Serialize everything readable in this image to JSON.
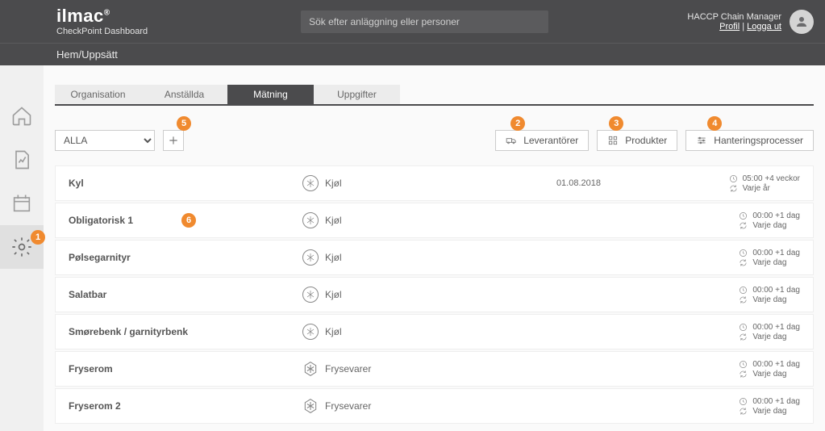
{
  "header": {
    "brand_main": "ilmac",
    "brand_sub": "CheckPoint Dashboard",
    "search_placeholder": "Sök efter anläggning eller personer",
    "role_label": "HACCP Chain Manager",
    "profile_link": "Profil",
    "separator": " | ",
    "logout_link": "Logga ut"
  },
  "breadcrumbs": {
    "home": "Hem",
    "sep": " / ",
    "current": "Uppsätt"
  },
  "tabs": {
    "organisation": "Organisation",
    "anstallda": "Anställda",
    "matning": "Mätning",
    "uppgifter": "Uppgifter"
  },
  "toolbar": {
    "select_value": "ALLA",
    "leverantorer": "Leverantörer",
    "produkter": "Produkter",
    "hantering": "Hanteringsprocesser"
  },
  "annotations": {
    "n1": "1",
    "n2": "2",
    "n3": "3",
    "n4": "4",
    "n5": "5",
    "n6": "6"
  },
  "types": {
    "kjol": "Kjøl",
    "frysevarer": "Frysevarer"
  },
  "rows": [
    {
      "name": "Kyl",
      "type": "kjol",
      "date": "01.08.2018",
      "time": "05:00 +4 veckor",
      "repeat": "Varje år"
    },
    {
      "name": "Obligatorisk 1",
      "type": "kjol",
      "date": "",
      "time": "00:00 +1 dag",
      "repeat": "Varje dag"
    },
    {
      "name": "Pølsegarnityr",
      "type": "kjol",
      "date": "",
      "time": "00:00 +1 dag",
      "repeat": "Varje dag"
    },
    {
      "name": "Salatbar",
      "type": "kjol",
      "date": "",
      "time": "00:00 +1 dag",
      "repeat": "Varje dag"
    },
    {
      "name": "Smørebenk / garnityrbenk",
      "type": "kjol",
      "date": "",
      "time": "00:00 +1 dag",
      "repeat": "Varje dag"
    },
    {
      "name": "Fryserom",
      "type": "frysevarer",
      "date": "",
      "time": "00:00 +1 dag",
      "repeat": "Varje dag"
    },
    {
      "name": "Fryserom 2",
      "type": "frysevarer",
      "date": "",
      "time": "00:00 +1 dag",
      "repeat": "Varje dag"
    }
  ]
}
